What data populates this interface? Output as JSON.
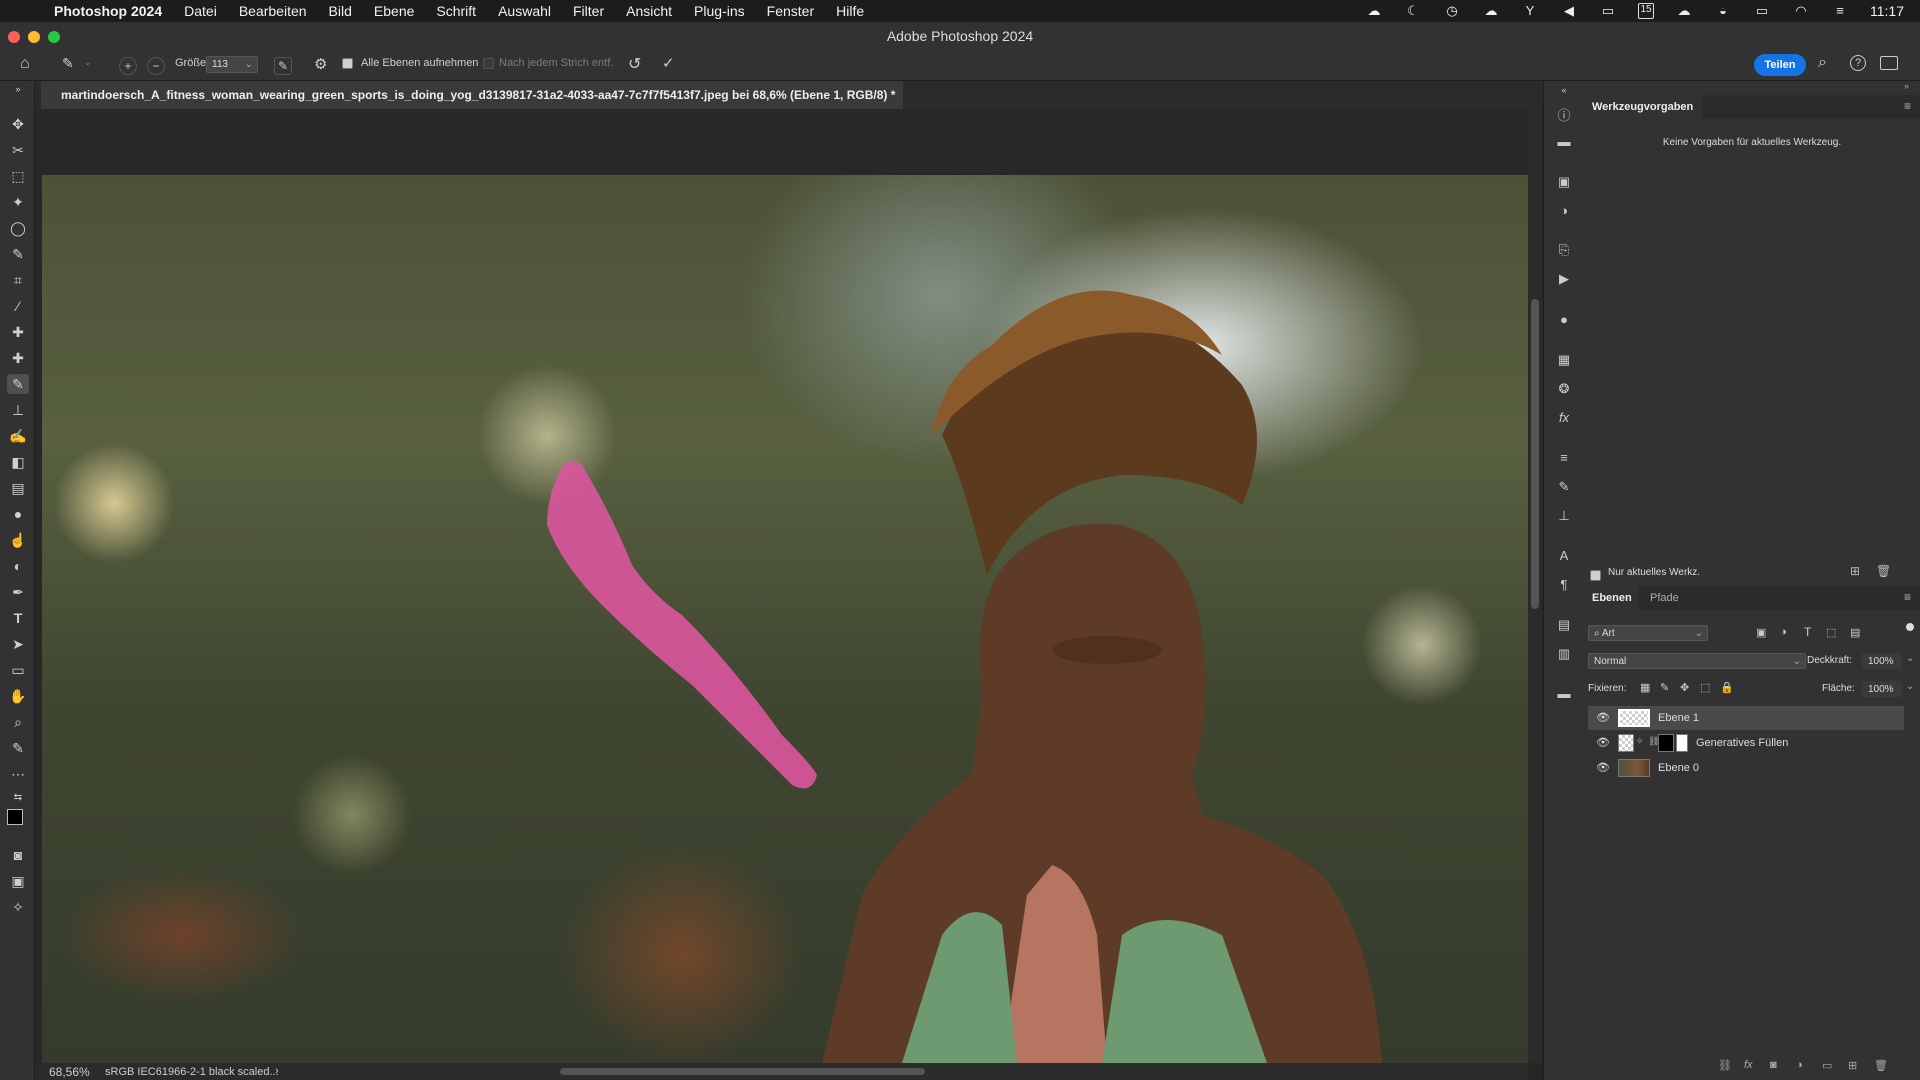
{
  "menubar": {
    "app_name": "Photoshop 2024",
    "items": [
      "Datei",
      "Bearbeiten",
      "Bild",
      "Ebene",
      "Schrift",
      "Auswahl",
      "Filter",
      "Ansicht",
      "Plug-ins",
      "Fenster",
      "Hilfe"
    ],
    "clock": "11:17",
    "calendar_day": "15"
  },
  "window": {
    "title": "Adobe Photoshop 2024"
  },
  "options": {
    "size_label": "Größe",
    "size_value": "113",
    "sample_all_label": "Alle Ebenen aufnehmen",
    "remove_after_stroke_label": "Nach jedem Strich entf.",
    "share_label": "Teilen"
  },
  "document": {
    "tab_title": "martindoersch_A_fitness_woman_wearing_green_sports_is_doing_yog_d3139817-31a2-4033-aa47-7c7f7f5413f7.jpeg bei 68,6% (Ebene 1, RGB/8) *",
    "zoom": "68,56%",
    "color_profile": "sRGB IEC61966-2-1 black scaled...",
    "stroke_color": "#d9569c"
  },
  "tool_presets": {
    "title": "Werkzeugvorgaben",
    "empty_message": "Keine Vorgaben für aktuelles Werkzeug.",
    "current_only_label": "Nur aktuelles Werkz."
  },
  "layers_panel": {
    "tabs": [
      "Ebenen",
      "Pfade"
    ],
    "filter_value": "Art",
    "blend_mode": "Normal",
    "opacity_label": "Deckkraft:",
    "opacity_value": "100%",
    "lock_label": "Fixieren:",
    "fill_label": "Fläche:",
    "fill_value": "100%",
    "layers": [
      {
        "name": "Ebene 1"
      },
      {
        "name": "Generatives Füllen"
      },
      {
        "name": "Ebene 0"
      }
    ]
  }
}
